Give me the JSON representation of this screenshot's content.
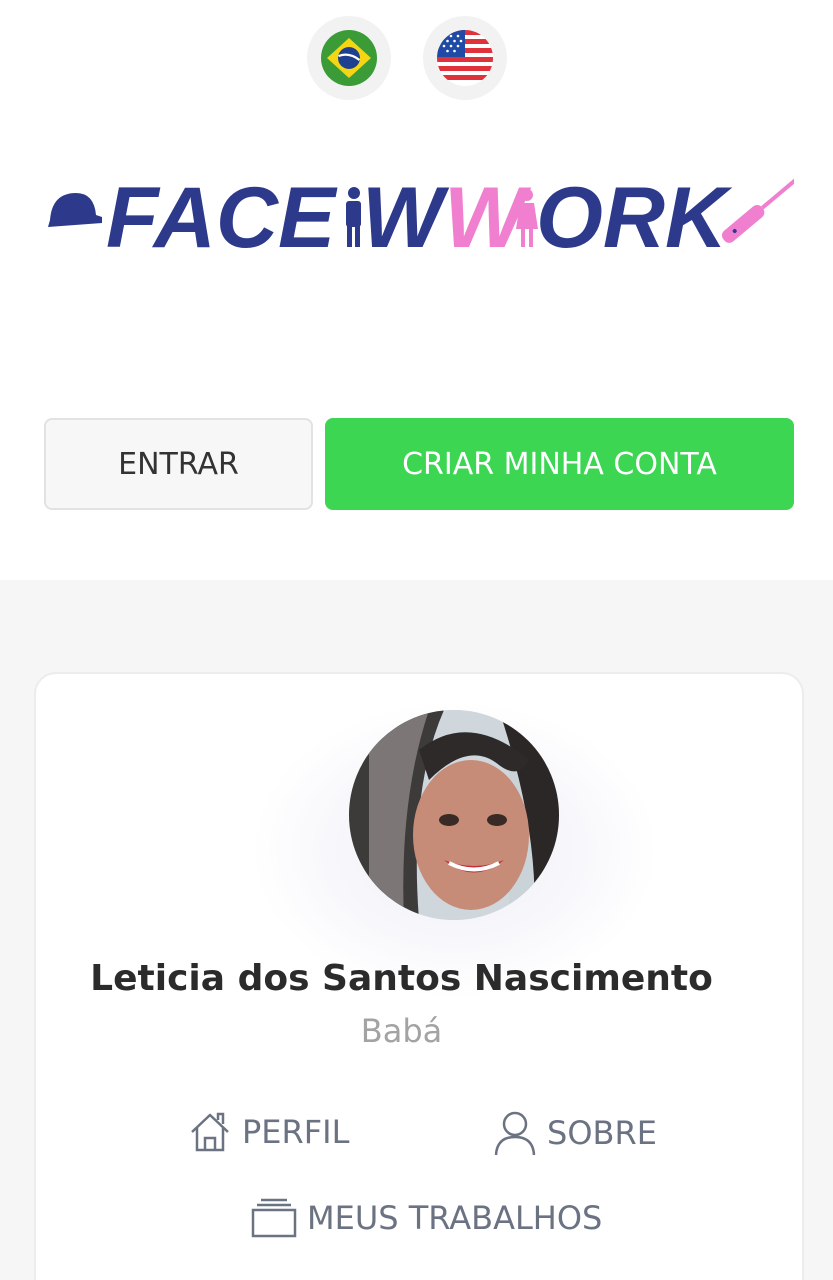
{
  "language": {
    "options": [
      {
        "name": "Português (Brasil)",
        "icon": "brazil-flag-icon"
      },
      {
        "name": "English (US)",
        "icon": "usa-flag-icon"
      }
    ]
  },
  "brand": {
    "logo_text": "FACEWWORK",
    "colors": {
      "blue": "#2d3a8c",
      "pink": "#f07fcf"
    }
  },
  "auth": {
    "login_label": "ENTRAR",
    "signup_label": "CRIAR MINHA CONTA",
    "signup_color": "#3cd653"
  },
  "profile": {
    "name": "Leticia dos Santos Nascimento",
    "role": "Babá",
    "avatar_icon": "profile-photo"
  },
  "nav": {
    "perfil": {
      "label": "PERFIL",
      "icon": "home-icon"
    },
    "sobre": {
      "label": "SOBRE",
      "icon": "user-icon"
    },
    "trabalhos": {
      "label": "MEUS TRABALHOS",
      "icon": "stack-icon"
    }
  }
}
